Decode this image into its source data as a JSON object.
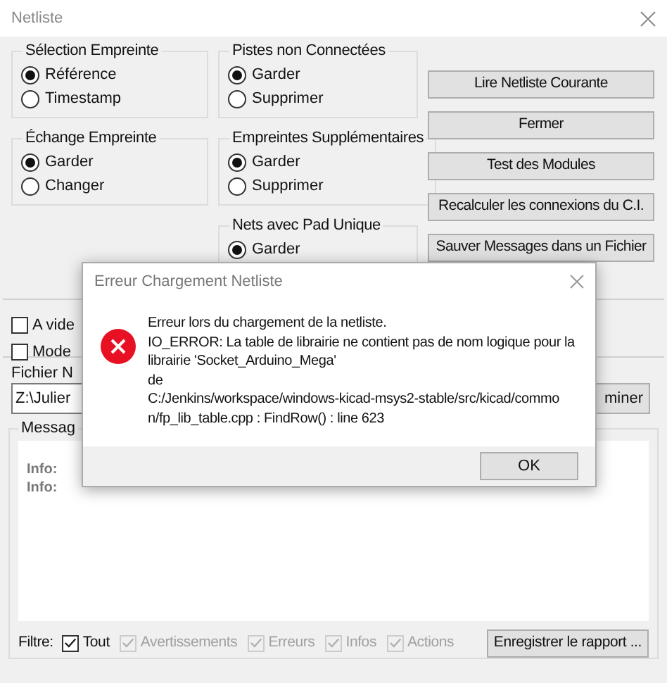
{
  "window": {
    "title": "Netliste"
  },
  "left_column": {
    "groups": [
      {
        "title": "Sélection  Empreinte",
        "options": [
          {
            "label": "Référence",
            "selected": true
          },
          {
            "label": "Timestamp",
            "selected": false
          }
        ]
      },
      {
        "title": "Échange Empreinte",
        "options": [
          {
            "label": "Garder",
            "selected": true
          },
          {
            "label": "Changer",
            "selected": false
          }
        ]
      }
    ]
  },
  "middle_column": {
    "groups": [
      {
        "title": "Pistes non Connectées",
        "options": [
          {
            "label": "Garder",
            "selected": true
          },
          {
            "label": "Supprimer",
            "selected": false
          }
        ]
      },
      {
        "title": "Empreintes Supplémentaires",
        "options": [
          {
            "label": "Garder",
            "selected": true
          },
          {
            "label": "Supprimer",
            "selected": false
          }
        ]
      },
      {
        "title": "Nets avec Pad Unique",
        "options": [
          {
            "label": "Garder",
            "selected": true
          }
        ]
      }
    ]
  },
  "buttons": [
    "Lire Netliste Courante",
    "Fermer",
    "Test des Modules",
    "Recalculer les connexions du C.I.",
    "Sauver Messages dans un Fichier"
  ],
  "options": [
    {
      "label": "A vide",
      "checked": false
    },
    {
      "label": "Mode",
      "checked": false
    }
  ],
  "file": {
    "label": "Fichier N",
    "value": "Z:\\Julier",
    "button": "miner"
  },
  "messages": {
    "title": "Messag",
    "lines": [
      "Info:",
      "Info:"
    ],
    "filter_label": "Filtre:",
    "filters": [
      {
        "label": "Tout",
        "checked": true,
        "disabled": false
      },
      {
        "label": "Avertissements",
        "checked": true,
        "disabled": true
      },
      {
        "label": "Erreurs",
        "checked": true,
        "disabled": true
      },
      {
        "label": "Infos",
        "checked": true,
        "disabled": true
      },
      {
        "label": "Actions",
        "checked": true,
        "disabled": true
      }
    ],
    "save_button": "Enregistrer le rapport ..."
  },
  "error_dialog": {
    "title": "Erreur Chargement Netliste",
    "lines": [
      "Erreur lors du chargement de la netliste.",
      "IO_ERROR: La table de librairie ne contient pas de nom logique pour la",
      "librairie 'Socket_Arduino_Mega'",
      "de",
      "C:/Jenkins/workspace/windows-kicad-msys2-stable/src/kicad/commo",
      "n/fp_lib_table.cpp : FindRow() : line 623"
    ],
    "button": "OK"
  }
}
